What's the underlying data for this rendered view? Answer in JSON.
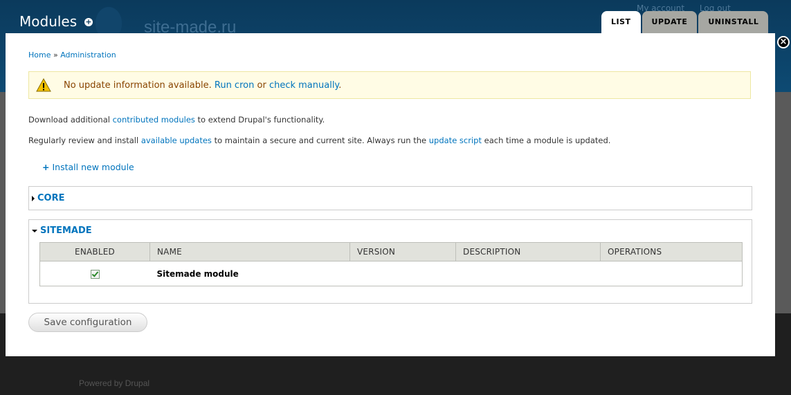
{
  "background": {
    "site_name": "site-made.ru",
    "user_links": [
      "My account",
      "Log out"
    ],
    "footer": "Powered by Drupal"
  },
  "overlay": {
    "title": "Modules",
    "tabs": [
      "LIST",
      "UPDATE",
      "UNINSTALL"
    ],
    "active_tab": "LIST",
    "close_label": "×"
  },
  "breadcrumb": {
    "home": "Home",
    "separator": "»",
    "admin": "Administration"
  },
  "message": {
    "text": "No update information available.",
    "link1": "Run cron",
    "or": "or",
    "link2": "check manually",
    "end": "."
  },
  "help": {
    "line1_pre": "Download additional",
    "line1_link": "contributed modules",
    "line1_post": "to extend Drupal's functionality.",
    "line2_pre": "Regularly review and install",
    "line2_link1": "available updates",
    "line2_mid": "to maintain a secure and current site. Always run the",
    "line2_link2": "update script",
    "line2_post": "each time a module is updated."
  },
  "install_link": "Install new module",
  "fieldsets": {
    "core": "CORE",
    "sitemade": "SITEMADE"
  },
  "table": {
    "headers": [
      "ENABLED",
      "NAME",
      "VERSION",
      "DESCRIPTION",
      "OPERATIONS"
    ],
    "rows": [
      {
        "enabled": true,
        "name": "Sitemade module",
        "version": "",
        "description": "",
        "operations": ""
      }
    ]
  },
  "save_button": "Save configuration",
  "colors": {
    "link": "#0074bd",
    "warning_bg": "#fffce5",
    "header_bg": "#0b3a5c"
  }
}
